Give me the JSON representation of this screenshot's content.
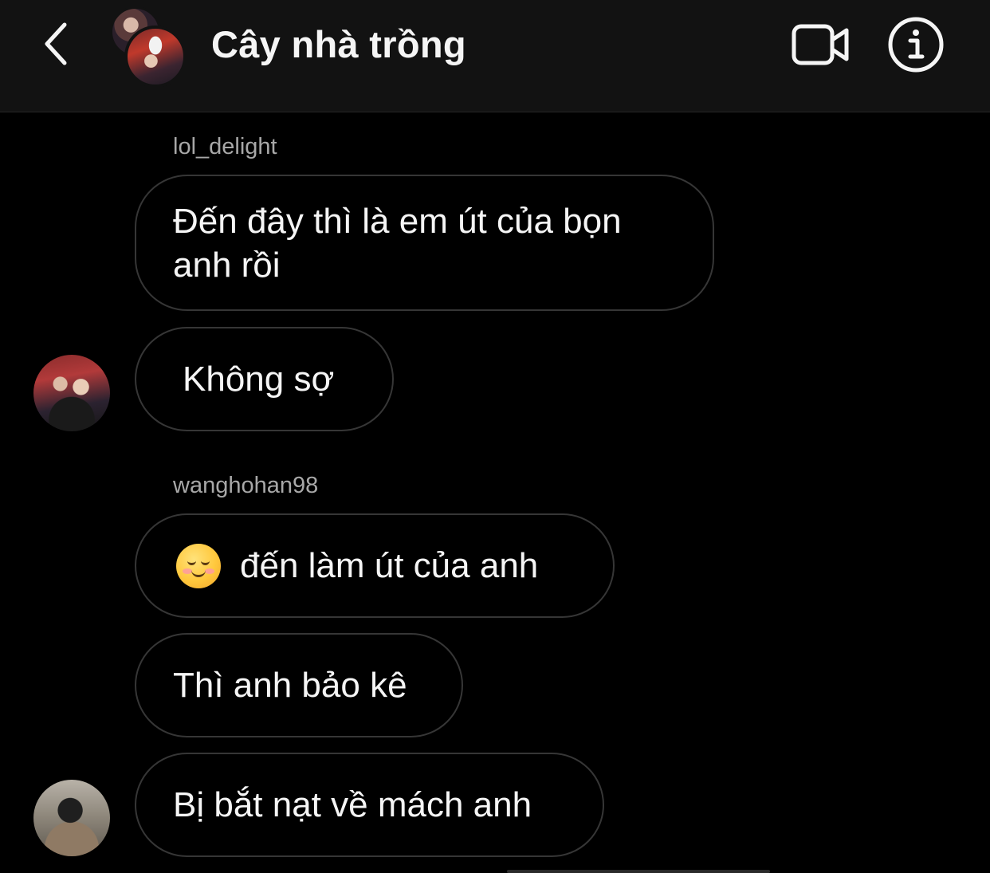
{
  "header": {
    "back_icon": "chevron-left-icon",
    "title": "Cây nhà trồng",
    "video_icon": "video-camera-icon",
    "info_icon": "info-icon"
  },
  "messages": [
    {
      "sender": "lol_delight",
      "text": "Đến đây thì là em út của bọn\nanh rồi"
    },
    {
      "text": "Không sợ"
    },
    {
      "sender": "wanghohan98",
      "emoji": "smiling-face-emoji",
      "text": "đến làm út của anh"
    },
    {
      "text": "Thì anh bảo kê"
    },
    {
      "text": "Bị bắt nạt về mách anh"
    }
  ],
  "colors": {
    "background": "#000000",
    "header_background": "#121212",
    "bubble_border": "#363636",
    "sender_name": "#a8a8a8",
    "text": "#f5f5f5"
  }
}
